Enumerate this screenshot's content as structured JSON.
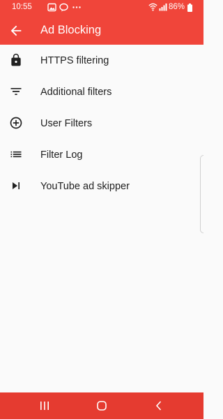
{
  "status_bar": {
    "time": "10:55",
    "left_icons": [
      "image-icon",
      "chat-icon",
      "more-dots-icon"
    ],
    "right_icons": [
      "wifi-icon",
      "signal-icon",
      "battery-icon"
    ],
    "battery": "86%"
  },
  "app_bar": {
    "title": "Ad Blocking",
    "back_icon": "arrow-back-icon"
  },
  "menu": {
    "items": [
      {
        "label": "HTTPS filtering",
        "icon": "lock-icon"
      },
      {
        "label": "Additional filters",
        "icon": "filter-icon"
      },
      {
        "label": "User Filters",
        "icon": "add-circle-icon"
      },
      {
        "label": "Filter Log",
        "icon": "list-icon"
      },
      {
        "label": "YouTube ad skipper",
        "icon": "skip-next-icon"
      }
    ]
  },
  "nav_bar": {
    "buttons": [
      "recent-apps-icon",
      "home-icon",
      "back-icon"
    ]
  },
  "colors": {
    "accent": "#f0453a",
    "nav_bar": "#e53b30",
    "background": "#fafafa",
    "text": "#212121"
  }
}
